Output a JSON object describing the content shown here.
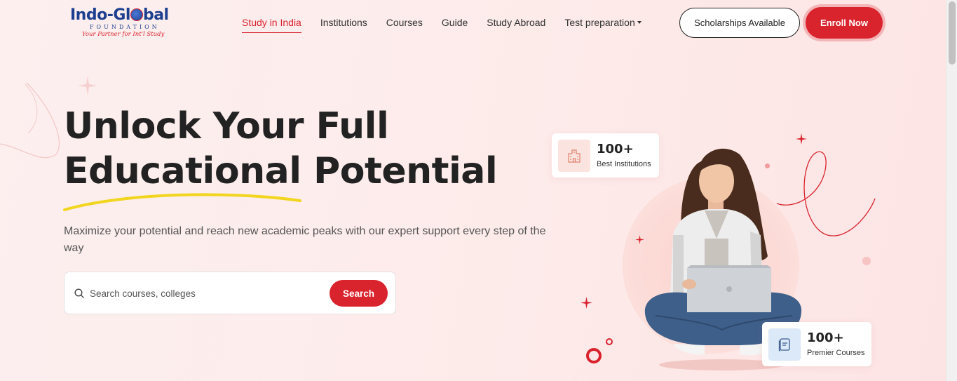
{
  "brand": {
    "name_part1": "Indo-Gl",
    "name_part2": "bal",
    "foundation": "FOUNDATION",
    "tagline": "Your Partner for Int'l Study"
  },
  "nav": {
    "items": [
      {
        "label": "Study in India",
        "active": true
      },
      {
        "label": "Institutions"
      },
      {
        "label": "Courses"
      },
      {
        "label": "Guide"
      },
      {
        "label": "Study Abroad"
      },
      {
        "label": "Test preparation",
        "dropdown": true
      }
    ]
  },
  "header": {
    "scholarships_label": "Scholarships Available",
    "enroll_label": "Enroll Now"
  },
  "hero": {
    "headline_line1": "Unlock Your Full",
    "headline_line2": "Educational Potential",
    "subtext": "Maximize your potential and reach new academic peaks with our expert support every step of the way",
    "search_placeholder": "Search courses, colleges",
    "search_button": "Search"
  },
  "stats": {
    "institutions": {
      "value": "100+",
      "label": "Best Institutions"
    },
    "courses": {
      "value": "100+",
      "label": "Premier Courses"
    }
  },
  "colors": {
    "accent": "#d9232d",
    "brand_blue": "#1e3f8f",
    "highlight": "#f2d51f"
  }
}
